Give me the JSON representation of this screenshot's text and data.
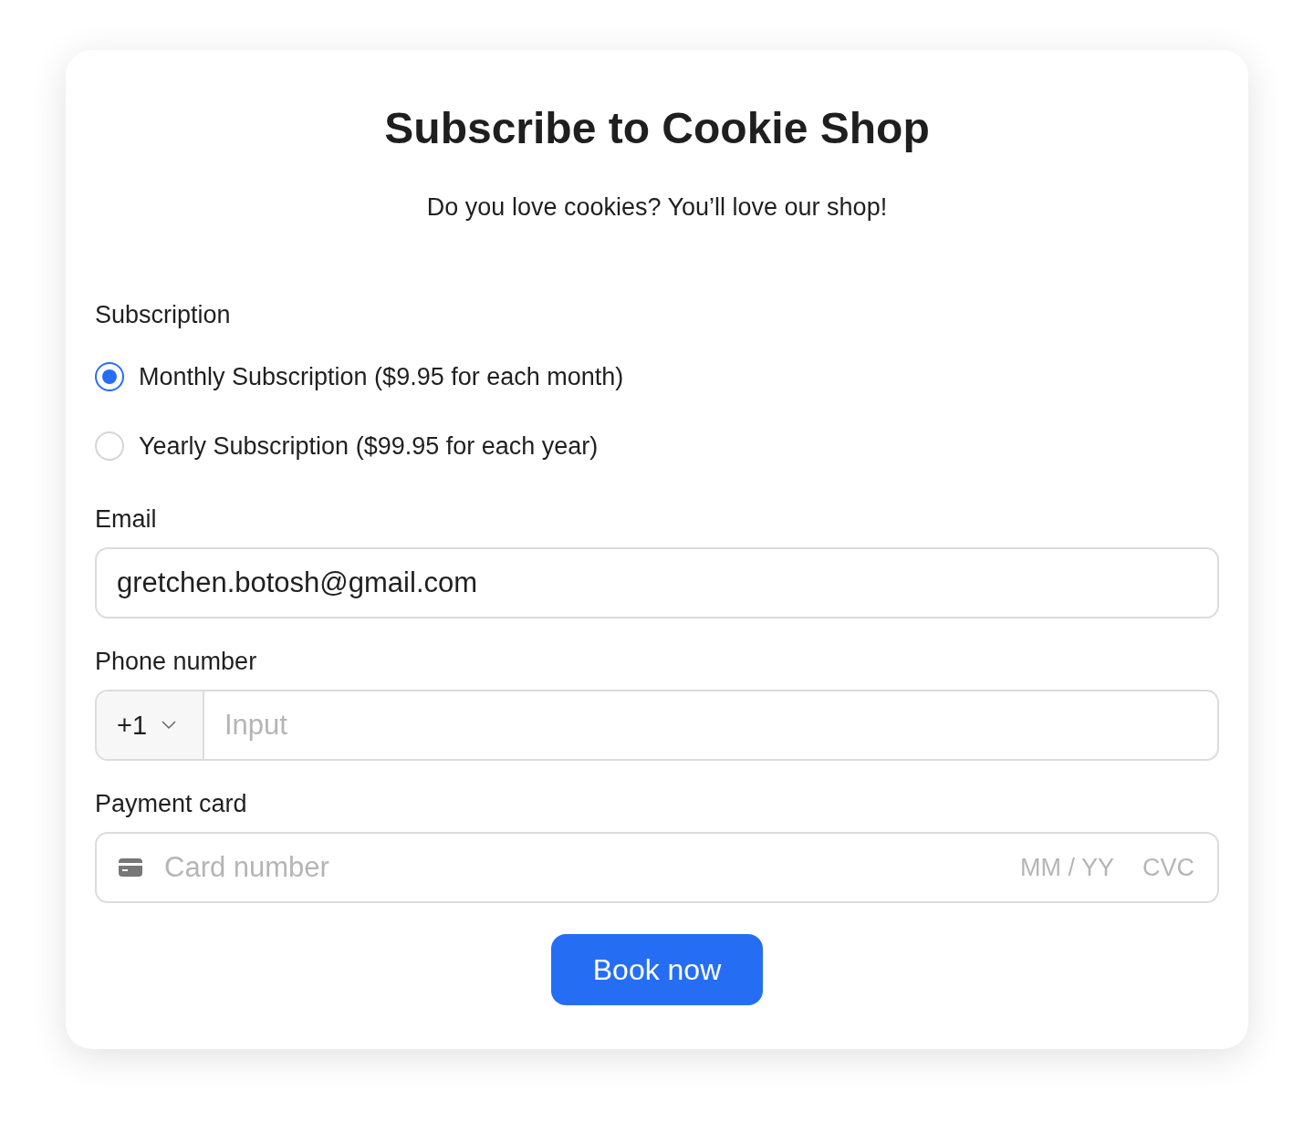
{
  "title": "Subscribe to Cookie Shop",
  "subtitle": "Do you love cookies? You’ll love our shop!",
  "subscription": {
    "label": "Subscription",
    "options": [
      {
        "label": "Monthly Subscription ($9.95 for each month)",
        "selected": true
      },
      {
        "label": "Yearly Subscription ($99.95 for each year)",
        "selected": false
      }
    ]
  },
  "email": {
    "label": "Email",
    "value": "gretchen.botosh@gmail.com"
  },
  "phone": {
    "label": "Phone number",
    "country_code": "+1",
    "placeholder": "Input"
  },
  "payment_card": {
    "label": "Payment card",
    "placeholder": "Card number",
    "expiry_placeholder": "MM / YY",
    "cvc_placeholder": "CVC"
  },
  "button": "Book now"
}
